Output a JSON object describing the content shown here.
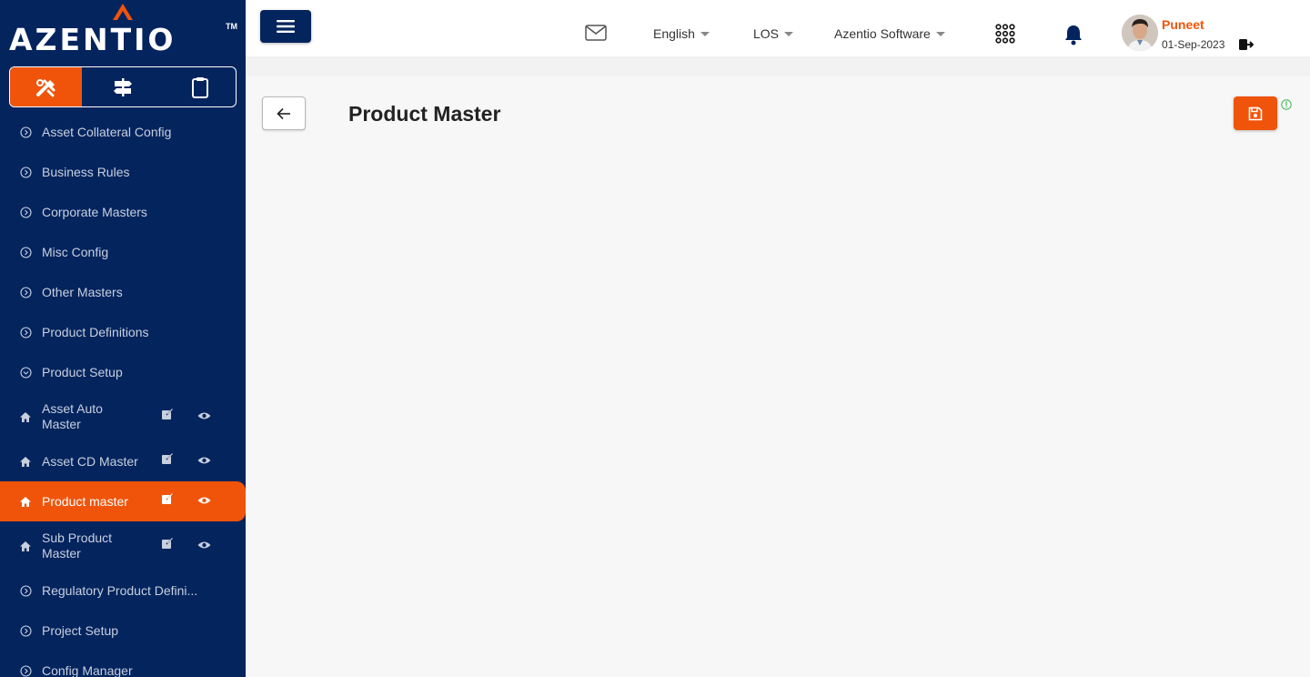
{
  "brand": {
    "name": "AZENTIO",
    "trademark": "TM"
  },
  "mode_tabs": [
    {
      "icon": "tools-icon",
      "active": true
    },
    {
      "icon": "signpost-icon",
      "active": false
    },
    {
      "icon": "clipboard-icon",
      "active": false
    }
  ],
  "sidebar": {
    "items": [
      {
        "label": "Asset Collateral Config",
        "icon": "chevron-circle-right-icon"
      },
      {
        "label": "Business Rules",
        "icon": "chevron-circle-right-icon"
      },
      {
        "label": "Corporate Masters",
        "icon": "chevron-circle-right-icon"
      },
      {
        "label": "Misc Config",
        "icon": "chevron-circle-right-icon"
      },
      {
        "label": "Other Masters",
        "icon": "chevron-circle-right-icon"
      },
      {
        "label": "Product Definitions",
        "icon": "chevron-circle-right-icon"
      },
      {
        "label": "Product Setup",
        "icon": "chevron-circle-down-icon"
      },
      {
        "label": "Asset Auto Master",
        "icon": "home-icon"
      },
      {
        "label": "Asset CD Master",
        "icon": "home-icon"
      },
      {
        "label": "Product master",
        "icon": "home-icon",
        "active": true
      },
      {
        "label": "Sub Product Master",
        "icon": "home-icon"
      },
      {
        "label": "Regulatory Product Defini...",
        "icon": "chevron-circle-right-icon"
      },
      {
        "label": "Project Setup",
        "icon": "chevron-circle-right-icon"
      },
      {
        "label": "Config Manager",
        "icon": "chevron-circle-right-icon"
      }
    ]
  },
  "header": {
    "language": "English",
    "module": "LOS",
    "organization": "Azentio Software",
    "user": {
      "name": "Puneet",
      "date": "01-Sep-2023"
    }
  },
  "page": {
    "title": "Product Master"
  },
  "colors": {
    "accent": "#f0540a",
    "navy": "#04245e",
    "background": "#f7f7f7"
  }
}
